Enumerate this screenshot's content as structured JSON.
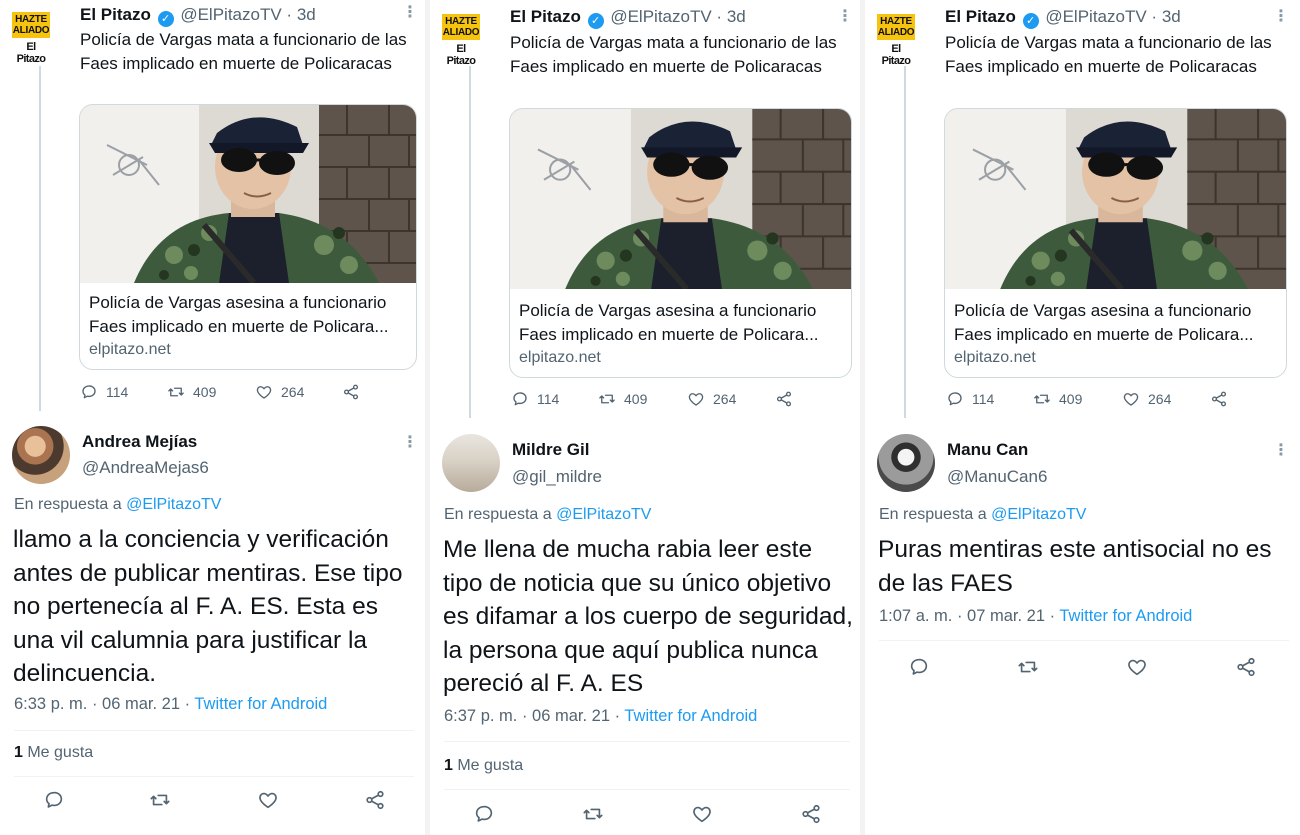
{
  "panels": [
    {
      "tweet": {
        "logo_line1": "HAZTE",
        "logo_line2": "ALIADO",
        "logo_brand": "El Pitazo",
        "name": "El Pitazo",
        "handle": "@ElPitazoTV",
        "separator": "·",
        "time": "3d",
        "text": "Policía de Vargas mata a funcionario de las Faes implicado en muerte de Policaracas",
        "card_title_1": "Policía de Vargas asesina a funcionario",
        "card_title_2": "Faes implicado en muerte de Policara...",
        "card_domain": "elpitazo.net",
        "replies": "114",
        "retweets": "409",
        "likes": "264"
      },
      "reply": {
        "name": "Andrea Mejías",
        "handle": "@AndreaMejas6",
        "in_reply_prefix": "En respuesta a",
        "in_reply_handle": "@ElPitazoTV",
        "text": "llamo a la conciencia y verificación antes de publicar mentiras. Ese tipo no pertenecía al F. A. ES. Esta es una vil calumnia para justificar la delincuencia.",
        "time": "6:33 p. m. · 06 mar. 21 · ",
        "source": "Twitter for Android",
        "likes_count": "1",
        "likes_label": " Me gusta"
      }
    },
    {
      "tweet": {
        "logo_line1": "HAZTE",
        "logo_line2": "ALIADO",
        "logo_brand": "El Pitazo",
        "name": "El Pitazo",
        "handle": "@ElPitazoTV",
        "separator": "·",
        "time": "3d",
        "text": "Policía de Vargas mata a funcionario de las Faes implicado en muerte de Policaracas",
        "card_title_1": "Policía de Vargas asesina a funcionario",
        "card_title_2": "Faes implicado en muerte de Policara...",
        "card_domain": "elpitazo.net",
        "replies": "114",
        "retweets": "409",
        "likes": "264"
      },
      "reply": {
        "name": "Mildre Gil",
        "handle": "@gil_mildre",
        "in_reply_prefix": "En respuesta a",
        "in_reply_handle": "@ElPitazoTV",
        "text": "Me llena de mucha rabia leer este tipo de noticia que su único objetivo es difamar a los cuerpo de seguridad, la persona que aquí publica nunca pereció al F. A. ES",
        "time": "6:37 p. m. · 06 mar. 21 · ",
        "source": "Twitter for Android",
        "likes_count": "1",
        "likes_label": " Me gusta"
      }
    },
    {
      "tweet": {
        "logo_line1": "HAZTE",
        "logo_line2": "ALIADO",
        "logo_brand": "El Pitazo",
        "name": "El Pitazo",
        "handle": "@ElPitazoTV",
        "separator": "·",
        "time": "3d",
        "text": "Policía de Vargas mata a funcionario de las Faes implicado en muerte de Policaracas",
        "card_title_1": "Policía de Vargas asesina a funcionario",
        "card_title_2": "Faes implicado en muerte de Policara...",
        "card_domain": "elpitazo.net",
        "replies": "114",
        "retweets": "409",
        "likes": "264"
      },
      "reply": {
        "name": "Manu Can",
        "handle": "@ManuCan6",
        "in_reply_prefix": "En respuesta a",
        "in_reply_handle": "@ElPitazoTV",
        "text": "Puras mentiras este antisocial no es de las FAES",
        "time": "1:07 a. m. · 07 mar. 21 · ",
        "source": "Twitter for Android"
      }
    }
  ],
  "icons": [
    "reply-icon",
    "retweet-icon",
    "like-icon",
    "share-icon",
    "more-icon",
    "verified-icon"
  ],
  "colors": {
    "link": "#1d9bf0",
    "secondary_text": "#536471",
    "logo_yellow": "#f6c40f"
  }
}
